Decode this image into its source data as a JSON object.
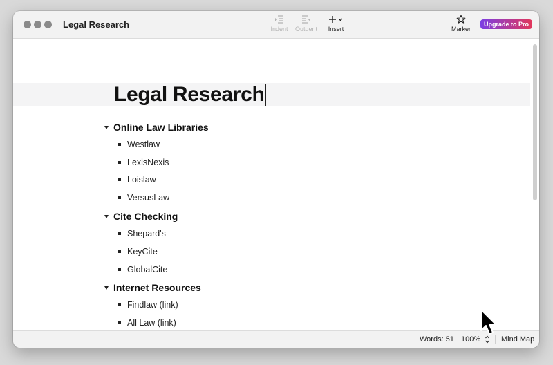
{
  "window": {
    "title": "Legal Research"
  },
  "toolbar": {
    "indent_label": "Indent",
    "outdent_label": "Outdent",
    "insert_label": "Insert",
    "marker_label": "Marker",
    "upgrade_label": "Upgrade to Pro"
  },
  "document": {
    "title": "Legal Research",
    "sections": [
      {
        "heading": "Online Law Libraries",
        "items": [
          "Westlaw",
          "LexisNexis",
          "Loislaw",
          "VersusLaw"
        ]
      },
      {
        "heading": "Cite Checking",
        "items": [
          "Shepard's",
          "KeyCite",
          "GlobalCite"
        ]
      },
      {
        "heading": "Internet Resources",
        "items": [
          "Findlaw (link)",
          "All Law (link)"
        ]
      }
    ]
  },
  "status": {
    "words": "Words: 51",
    "zoom": "100%",
    "mode": "Mind Map"
  },
  "colors": {
    "upgrade_gradient_start": "#7b3fe4",
    "upgrade_gradient_end": "#e2365a",
    "title_band": "#f4f4f5"
  },
  "icons": {
    "indent": "indent-icon",
    "outdent": "outdent-icon",
    "insert": "plus-icon",
    "marker": "star-icon",
    "zoom_stepper": "chevron-up-down-icon"
  }
}
